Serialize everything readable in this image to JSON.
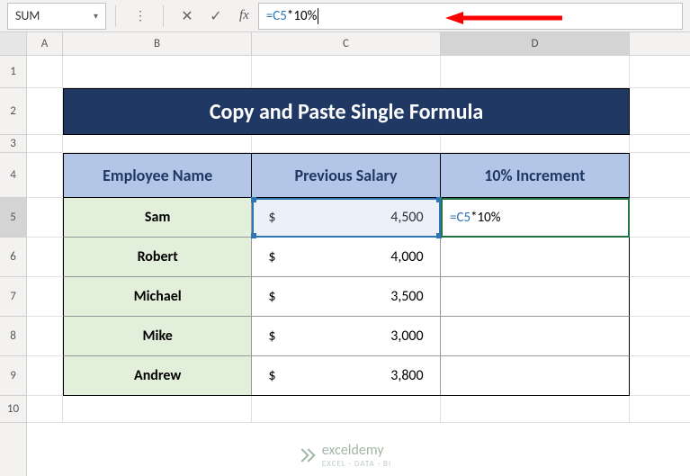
{
  "formula_bar": {
    "name_box": "SUM",
    "formula_ref": "=C5",
    "formula_rest": "*10%"
  },
  "columns": [
    "A",
    "B",
    "C",
    "D"
  ],
  "rows": [
    "1",
    "2",
    "3",
    "4",
    "5",
    "6",
    "7",
    "8",
    "9",
    "10"
  ],
  "active_row": "5",
  "active_col": "D",
  "title": "Copy and Paste Single Formula",
  "headers": {
    "B": "Employee Name",
    "C": "Previous Salary",
    "D": "10% Increment"
  },
  "table": [
    {
      "name": "Sam",
      "salary": "4,500",
      "increment": "=C5*10%"
    },
    {
      "name": "Robert",
      "salary": "4,000",
      "increment": ""
    },
    {
      "name": "Michael",
      "salary": "3,500",
      "increment": ""
    },
    {
      "name": "Mike",
      "salary": "3,000",
      "increment": ""
    },
    {
      "name": "Andrew",
      "salary": "3,800",
      "increment": ""
    }
  ],
  "currency": "$",
  "editing_cell": {
    "ref_part": "=C5",
    "rest_part": "*10%"
  },
  "watermark": {
    "name": "exceldemy",
    "sub": "EXCEL · DATA · BI"
  }
}
